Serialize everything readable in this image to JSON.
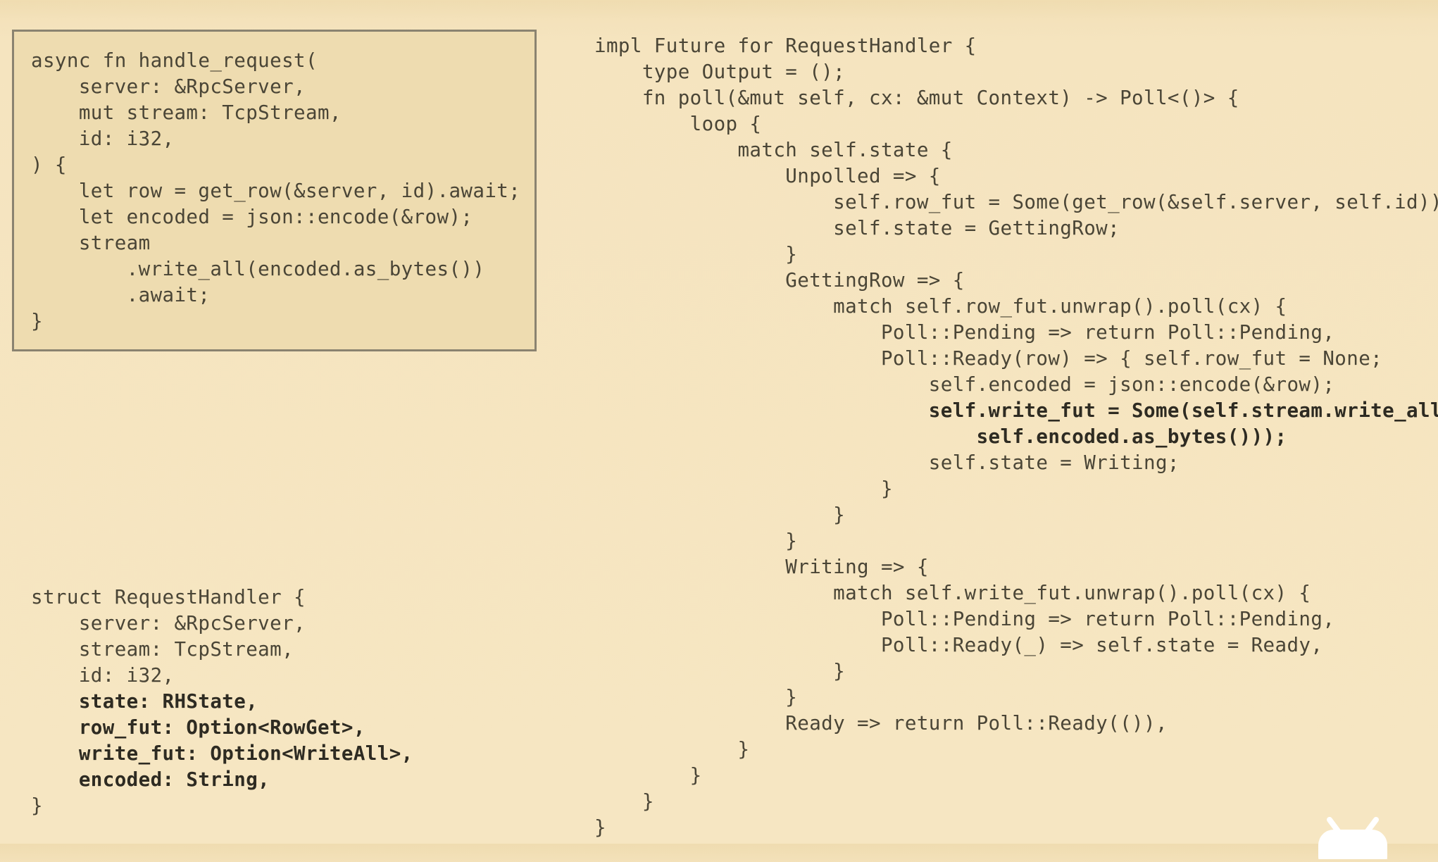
{
  "slide": {
    "async_fn_code": [
      "async fn handle_request(",
      "    server: &RpcServer,",
      "    mut stream: TcpStream,",
      "    id: i32,",
      ") {",
      "    let row = get_row(&server, id).await;",
      "    let encoded = json::encode(&row);",
      "    stream",
      "        .write_all(encoded.as_bytes())",
      "        .await;",
      "}"
    ],
    "struct_code": [
      "struct RequestHandler {",
      "    server: &RpcServer,",
      "    stream: TcpStream,",
      "    id: i32,",
      "    state: RHState,",
      "    row_fut: Option<RowGet>,",
      "    write_fut: Option<WriteAll>,",
      "    encoded: String,",
      "}"
    ],
    "impl_code": [
      "impl Future for RequestHandler {",
      "    type Output = ();",
      "    fn poll(&mut self, cx: &mut Context) -> Poll<()> {",
      "        loop {",
      "            match self.state {",
      "                Unpolled => {",
      "                    self.row_fut = Some(get_row(&self.server, self.id));",
      "                    self.state = GettingRow;",
      "                }",
      "                GettingRow => {",
      "                    match self.row_fut.unwrap().poll(cx) {",
      "                        Poll::Pending => return Poll::Pending,",
      "                        Poll::Ready(row) => { self.row_fut = None;",
      "                            self.encoded = json::encode(&row);",
      "                            self.write_fut = Some(self.stream.write_all(",
      "                                self.encoded.as_bytes()));",
      "                            self.state = Writing;",
      "                        }",
      "                    }",
      "                }",
      "                Writing => {",
      "                    match self.write_fut.unwrap().poll(cx) {",
      "                        Poll::Pending => return Poll::Pending,",
      "                        Poll::Ready(_) => self.state = Ready,",
      "                    }",
      "                }",
      "                Ready => return Poll::Ready(()),",
      "            }",
      "        }",
      "    }",
      "}"
    ]
  },
  "colors": {
    "background": "#f5e4bf",
    "box_fill": "#eedcb0",
    "box_border": "#8a8370",
    "code_text": "#4a4536",
    "highlight_text": "#2e2b22",
    "watermark": "#ffffff"
  },
  "icons": {
    "watermark": "tv-logo-icon"
  }
}
